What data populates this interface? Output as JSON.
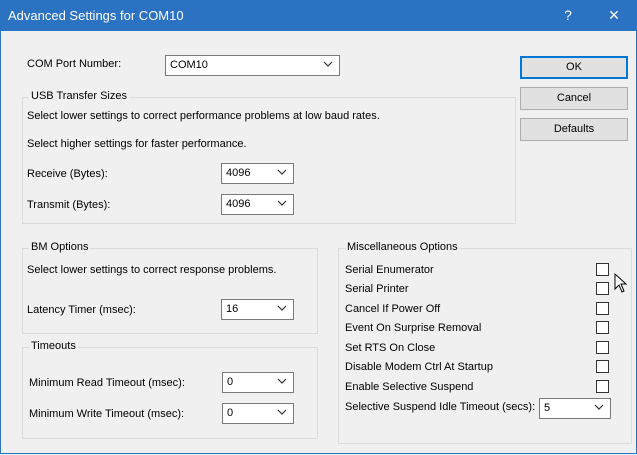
{
  "window": {
    "title": "Advanced Settings for COM10",
    "help_glyph": "?",
    "close_glyph": "✕"
  },
  "com_port": {
    "label": "COM Port Number:",
    "value": "COM10"
  },
  "buttons": {
    "ok": "OK",
    "cancel": "Cancel",
    "defaults": "Defaults"
  },
  "usb": {
    "title": "USB Transfer Sizes",
    "hint1": "Select lower settings to correct performance problems at low baud rates.",
    "hint2": "Select higher settings for faster performance.",
    "receive_label": "Receive (Bytes):",
    "receive_value": "4096",
    "transmit_label": "Transmit (Bytes):",
    "transmit_value": "4096"
  },
  "bm": {
    "title": "BM Options",
    "hint": "Select lower settings to correct response problems.",
    "latency_label": "Latency Timer (msec):",
    "latency_value": "16"
  },
  "timeouts": {
    "title": "Timeouts",
    "read_label": "Minimum Read Timeout (msec):",
    "read_value": "0",
    "write_label": "Minimum Write Timeout (msec):",
    "write_value": "0"
  },
  "misc": {
    "title": "Miscellaneous Options",
    "options": [
      {
        "label": "Serial Enumerator",
        "checked": false
      },
      {
        "label": "Serial Printer",
        "checked": false
      },
      {
        "label": "Cancel If Power Off",
        "checked": false
      },
      {
        "label": "Event On Surprise Removal",
        "checked": false
      },
      {
        "label": "Set RTS On Close",
        "checked": false
      },
      {
        "label": "Disable Modem Ctrl At Startup",
        "checked": false
      },
      {
        "label": "Enable Selective Suspend",
        "checked": false
      }
    ],
    "idle_label": "Selective Suspend Idle Timeout (secs):",
    "idle_value": "5"
  }
}
